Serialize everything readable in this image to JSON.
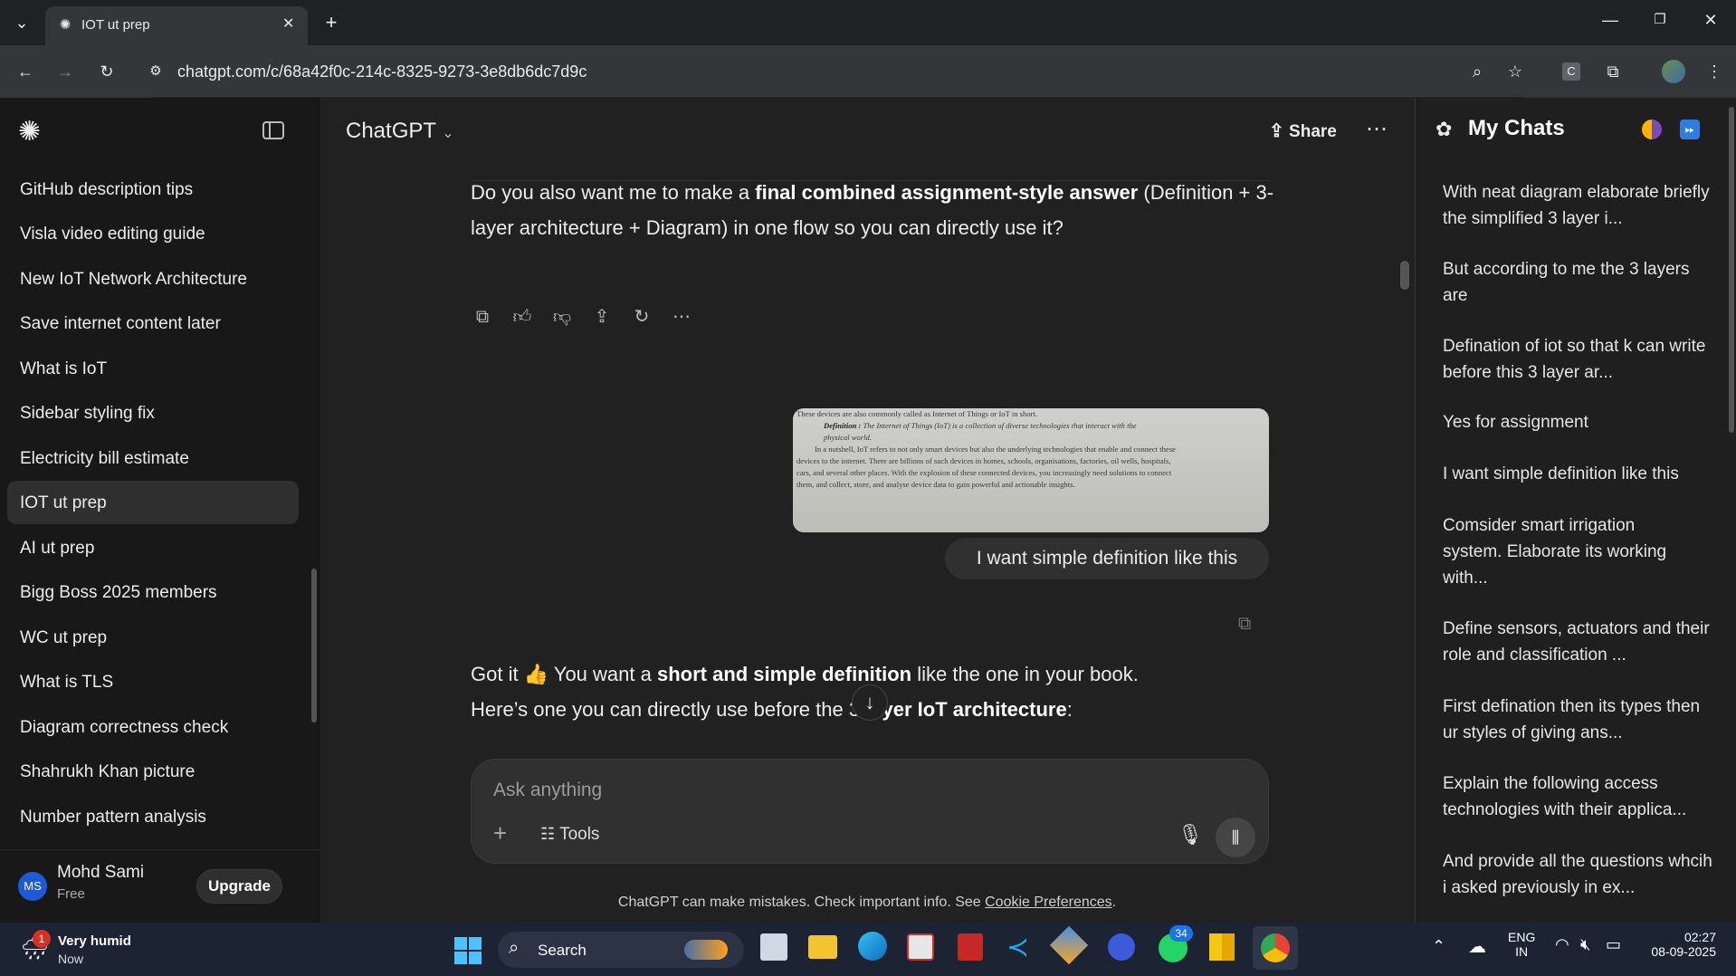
{
  "browser": {
    "tab_title": "IOT ut prep",
    "url": "chatgpt.com/c/68a42f0c-214c-8325-9273-3e8db6dc7d9c"
  },
  "sidebar": {
    "items": [
      {
        "label": "GitHub description tips"
      },
      {
        "label": "Visla video editing guide"
      },
      {
        "label": "New IoT Network Architecture"
      },
      {
        "label": "Save internet content later"
      },
      {
        "label": "What is IoT"
      },
      {
        "label": "Sidebar styling fix"
      },
      {
        "label": "Electricity bill estimate"
      },
      {
        "label": "IOT ut prep"
      },
      {
        "label": "AI ut prep"
      },
      {
        "label": "Bigg Boss 2025 members"
      },
      {
        "label": "WC ut prep"
      },
      {
        "label": "What is TLS"
      },
      {
        "label": "Diagram correctness check"
      },
      {
        "label": "Shahrukh Khan picture"
      },
      {
        "label": "Number pattern analysis"
      }
    ],
    "user": {
      "initials": "MS",
      "name": "Mohd Sami",
      "plan": "Free",
      "upgrade": "Upgrade"
    }
  },
  "header": {
    "model": "ChatGPT",
    "share": "Share"
  },
  "conversation": {
    "msg1": {
      "p1": "Do you also want me to make a ",
      "b1": "final combined assignment-style answer",
      "p2": " (Definition + 3-",
      "line2": "layer architecture + Diagram) in one flow so you can directly use it?"
    },
    "image_text": {
      "l0": "These devices are also commonly called as Internet of Things or IoT in short.",
      "l1a": "Definition : ",
      "l1b": "The Internet of Things (IoT) is a collection of diverse technologies that interact with the",
      "l2": "physical world.",
      "l3": "In a nutshell, IoT refers to not only smart devices but also the underlying technologies that enable and connect these",
      "l4": "devices to the internet. There are billions of such devices in homes, schools, organisations, factories, oil wells, hospitals,",
      "l5": "cars, and several other places. With the explosion of these connected devices, you increasingly need solutions to connect",
      "l6": "them, and collect, store, and analyse device data to gain powerful and actionable insights."
    },
    "user_msg": "I want simple definition like this",
    "msg2": {
      "a": "Got it 👍 You want a ",
      "b": "short and simple definition",
      "c": " like the one in your book.",
      "d": "Here’s one you can directly use before the 3",
      "e": "yer IoT architecture",
      "f": ":"
    }
  },
  "composer": {
    "placeholder": "Ask anything",
    "tools": "Tools"
  },
  "footer": {
    "text": "ChatGPT can make mistakes. Check important info. See ",
    "link": "Cookie Preferences",
    "end": "."
  },
  "right_panel": {
    "title": "My Chats",
    "items": [
      "With neat diagram elaborate briefly the simplified 3 layer i...",
      "But according to me the 3 layers are",
      "Defination of iot so that k can write before this 3 layer ar...",
      "Yes for assignment",
      "I want simple definition like this",
      "Comsider smart irrigation system. Elaborate its working with...",
      "Define sensors, actuators and their role and classification ...",
      "First defination then its types then ur styles of giving ans...",
      "Explain the following access technologies with their applica...",
      "And provide all the questions whcih i asked previously in ex..."
    ]
  },
  "taskbar": {
    "weather_title": "Very humid",
    "weather_sub": "Now",
    "weather_badge": "1",
    "search": "Search",
    "whatsapp_badge": "34",
    "lang1": "ENG",
    "lang2": "IN",
    "time": "02:27",
    "date": "08-09-2025"
  },
  "colors": {
    "accent": "#ffffff",
    "taskbar": "#1c2333",
    "app_bg": "#212121"
  }
}
